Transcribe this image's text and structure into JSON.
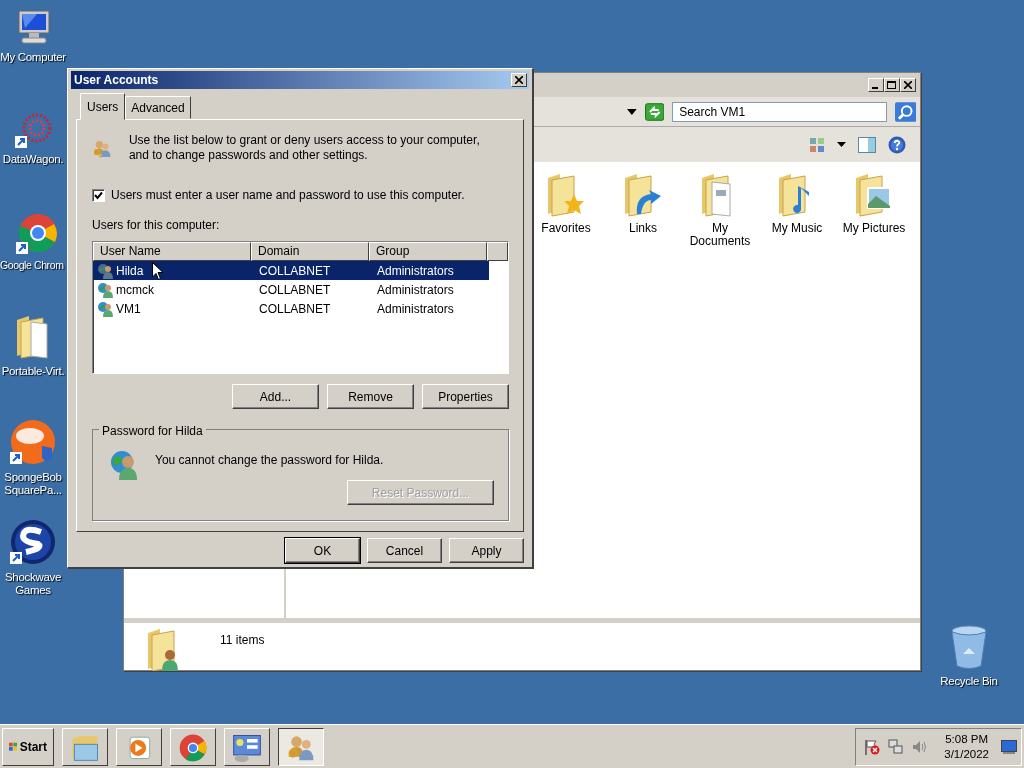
{
  "desktop_icons": [
    {
      "kind": "computer",
      "label": "My Computer"
    },
    {
      "kind": "burst",
      "label": "DataWagon."
    },
    {
      "kind": "chrome",
      "label": "Google Chrom"
    },
    {
      "kind": "folder",
      "label": "Portable-Virt."
    },
    {
      "kind": "nick",
      "label": "SpongeBob SquarePa..."
    },
    {
      "kind": "shockwave",
      "label": "Shockwave Games"
    },
    {
      "kind": "recycle",
      "label": "Recycle Bin"
    }
  ],
  "explorer": {
    "search": {
      "placeholder": "Search VM1"
    },
    "folders": [
      {
        "kind": "star",
        "label": "Favorites"
      },
      {
        "kind": "link",
        "label": "Links"
      },
      {
        "kind": "docs",
        "label": "My Documents"
      },
      {
        "kind": "music",
        "label": "My Music"
      },
      {
        "kind": "pictures",
        "label": "My Pictures"
      }
    ],
    "status": "11 items"
  },
  "dialog": {
    "title": "User Accounts",
    "tabs": [
      {
        "label": "Users",
        "selected": true
      },
      {
        "label": "Advanced",
        "selected": false
      }
    ],
    "intro": "Use the list below to grant or deny users access to your computer, and to change passwords and other settings.",
    "require_password": {
      "label": "Users must enter a user name and password to use this computer.",
      "checked": true
    },
    "users_label": "Users for this computer:",
    "columns": [
      "User Name",
      "Domain",
      "Group"
    ],
    "rows": [
      {
        "cells": [
          "Hilda",
          "COLLABNET",
          "Administrators"
        ],
        "selected": true
      },
      {
        "cells": [
          "mcmck",
          "COLLABNET",
          "Administrators"
        ],
        "selected": false
      },
      {
        "cells": [
          "VM1",
          "COLLABNET",
          "Administrators"
        ],
        "selected": false
      }
    ],
    "list_buttons": [
      "Add...",
      "Remove",
      "Properties"
    ],
    "password_group": {
      "title": "Password for Hilda",
      "message": "You cannot change the password for Hilda.",
      "reset_button": {
        "label": "Reset Password...",
        "disabled": true
      }
    },
    "footer_buttons": [
      {
        "label": "OK",
        "default": true
      },
      {
        "label": "Cancel",
        "default": false
      },
      {
        "label": "Apply",
        "default": false
      }
    ]
  },
  "taskbar": {
    "start": "Start",
    "items": [
      {
        "kind": "explorer",
        "active": false
      },
      {
        "kind": "media",
        "active": false
      },
      {
        "kind": "chrome",
        "active": false
      },
      {
        "kind": "control",
        "active": false
      },
      {
        "kind": "users",
        "active": true
      }
    ],
    "time": "5:08 PM",
    "date": "3/1/2022"
  }
}
